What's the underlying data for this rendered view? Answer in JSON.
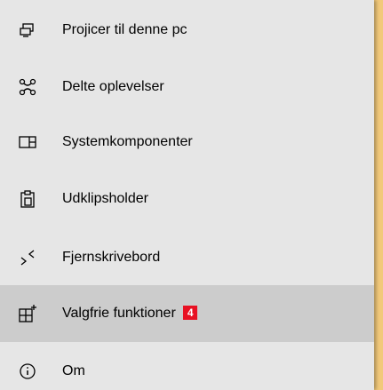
{
  "menu": {
    "items": [
      {
        "label": "Projicer til denne pc",
        "icon": "project-icon"
      },
      {
        "label": "Delte oplevelser",
        "icon": "shared-experiences-icon"
      },
      {
        "label": "Systemkomponenter",
        "icon": "system-components-icon"
      },
      {
        "label": "Udklipsholder",
        "icon": "clipboard-icon"
      },
      {
        "label": "Fjernskrivebord",
        "icon": "remote-desktop-icon"
      },
      {
        "label": "Valgfrie funktioner",
        "icon": "optional-features-icon",
        "badge": "4",
        "selected": true
      },
      {
        "label": "Om",
        "icon": "info-icon"
      }
    ]
  },
  "colors": {
    "panel_background": "#e6e6e6",
    "selected_background": "#cccccc",
    "badge": "#e81123",
    "border": "#f2c97a"
  }
}
